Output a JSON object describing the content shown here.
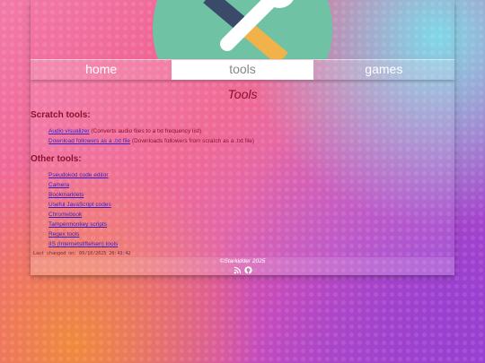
{
  "nav": {
    "items": [
      {
        "label": "home",
        "active": false
      },
      {
        "label": "tools",
        "active": true
      },
      {
        "label": "games",
        "active": false
      }
    ]
  },
  "main": {
    "title": "Tools",
    "scratch_heading": "Scratch tools:",
    "scratch_items": [
      {
        "link": "Audio visualizer",
        "note": " (Converts audio files to a txt frequency list)"
      },
      {
        "link": "Download followers as a .txt file",
        "note": " (Downloads followers from scratch as a .txt file)"
      }
    ],
    "other_heading": "Other tools:",
    "other_items": [
      {
        "link": "Pseudokod code editor"
      },
      {
        "link": "Camera"
      },
      {
        "link": "Bookmarklets"
      },
      {
        "link": "Useful JavaScript codes"
      },
      {
        "link": "Chromebook"
      },
      {
        "link": "Tampermonkey scripts"
      },
      {
        "link": "Regex tools"
      },
      {
        "link": "IIS (Internetstiftelsen) tools"
      }
    ],
    "last_changed": "Last changed on: 09/10/2025 20:43:42"
  },
  "footer": {
    "copyright": "©Starkidder 2025",
    "icons": [
      "rss-icon",
      "github-icon"
    ]
  },
  "colors": {
    "heading": "#8a1030",
    "link": "#3a1cc0",
    "hero_circle": "#6fc3a4"
  }
}
